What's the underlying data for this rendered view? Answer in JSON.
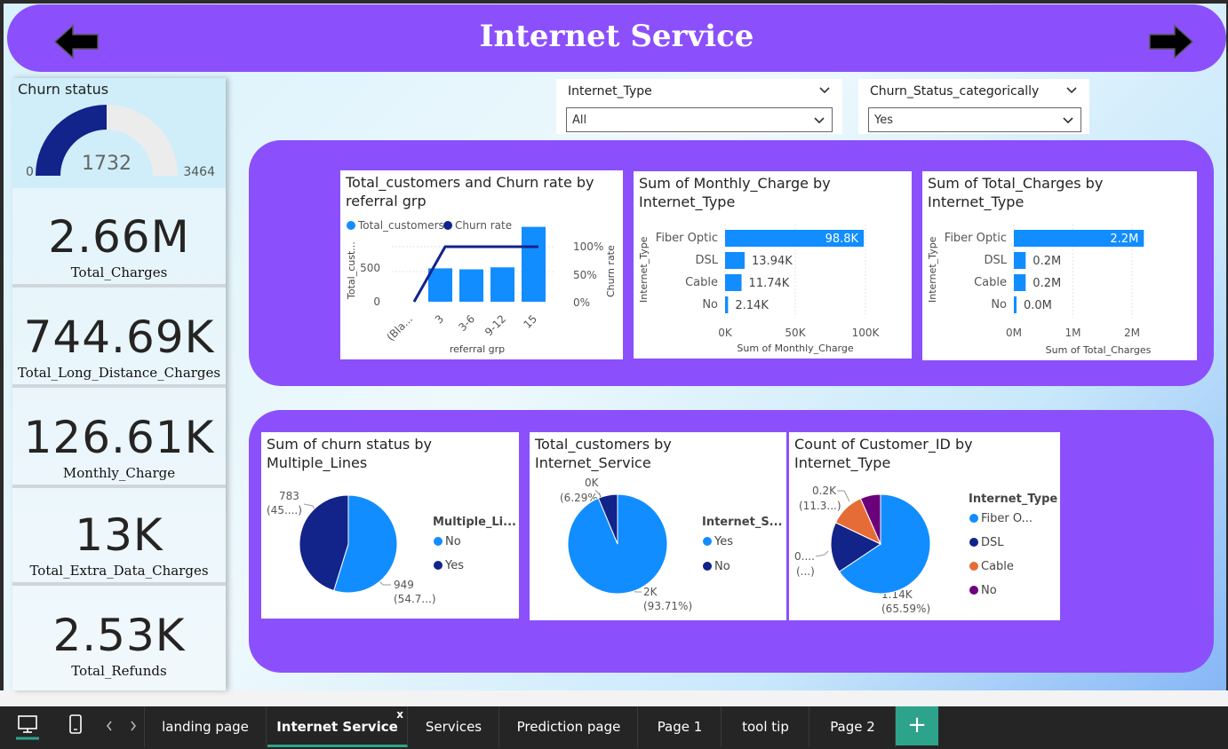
{
  "header": {
    "title": "Internet Service",
    "back_icon": "arrow-left-icon",
    "forward_icon": "arrow-right-icon"
  },
  "gauge": {
    "title": "Churn status",
    "value": "1732",
    "min": "0",
    "max": "3464",
    "fraction": 0.5,
    "fill_color": "#12238a",
    "track_color": "#ececec"
  },
  "kpis": [
    {
      "value": "2.66M",
      "label": "Total_Charges"
    },
    {
      "value": "744.69K",
      "label": "Total_Long_Distance_Charges"
    },
    {
      "value": "126.61K",
      "label": "Monthly_Charge"
    },
    {
      "value": "13K",
      "label": "Total_Extra_Data_Charges"
    },
    {
      "value": "2.53K",
      "label": "Total_Refunds"
    }
  ],
  "slicers": [
    {
      "title": "Internet_Type",
      "value": "All"
    },
    {
      "title": "Churn_Status_categorically",
      "value": "Yes"
    }
  ],
  "colors": {
    "accent": "#8b50fb",
    "bar": "#118dff",
    "dark": "#12238a",
    "orange": "#e66c37",
    "purple": "#6b007b",
    "tab_active": "#2ea38b"
  },
  "chart_data": [
    {
      "type": "bar",
      "title": "Total_customers and Churn rate by referral grp",
      "legend": [
        "Total_customers",
        "Churn rate"
      ],
      "categories": [
        "(Bla...",
        "3",
        "3-6",
        "9-12",
        "15"
      ],
      "series": [
        {
          "name": "Total_customers",
          "values": [
            0,
            330,
            320,
            340,
            740
          ]
        },
        {
          "name": "Churn rate",
          "values": [
            0,
            100,
            100,
            100,
            100
          ]
        }
      ],
      "xlabel": "referral grp",
      "ylabel": "Total_cust...",
      "y2label": "Churn rate",
      "y_ticks": [
        "0",
        "500"
      ],
      "y2_ticks": [
        "0%",
        "50%",
        "100%"
      ]
    },
    {
      "type": "bar",
      "title": "Sum of Monthly_Charge by Internet_Type",
      "categories": [
        "Fiber Optic",
        "DSL",
        "Cable",
        "No"
      ],
      "values": [
        98800,
        13940,
        11740,
        2140
      ],
      "labels": [
        "98.8K",
        "13.94K",
        "11.74K",
        "2.14K"
      ],
      "xlabel": "Sum of Monthly_Charge",
      "ylabel": "Internet_Type",
      "x_ticks": [
        "0K",
        "50K",
        "100K"
      ],
      "xlim": [
        0,
        100000
      ]
    },
    {
      "type": "bar",
      "title": "Sum of Total_Charges by Internet_Type",
      "categories": [
        "Fiber Optic",
        "DSL",
        "Cable",
        "No"
      ],
      "values": [
        2200000,
        200000,
        200000,
        0
      ],
      "labels": [
        "2.2M",
        "0.2M",
        "0.2M",
        "0.0M"
      ],
      "xlabel": "Sum of Total_Charges",
      "ylabel": "Internet_Type",
      "x_ticks": [
        "0M",
        "1M",
        "2M"
      ],
      "xlim": [
        0,
        2000000
      ]
    },
    {
      "type": "pie",
      "title": "Sum of churn status by Multiple_Lines",
      "legend_title": "Multiple_Li...",
      "categories": [
        "No",
        "Yes"
      ],
      "values": [
        949,
        783
      ],
      "labels": [
        [
          "949",
          "(54.7...)"
        ],
        [
          "783",
          "(45....)"
        ]
      ]
    },
    {
      "type": "pie",
      "title": "Total_customers by Internet_Service",
      "legend_title": "Internet_S...",
      "categories": [
        "Yes",
        "No"
      ],
      "values": [
        93.71,
        6.29
      ],
      "labels": [
        [
          "2K",
          "(93.71%)"
        ],
        [
          "0K",
          "(6.29%)"
        ]
      ]
    },
    {
      "type": "pie",
      "title": "Count of Customer_ID by Internet_Type",
      "legend_title": "Internet_Type",
      "categories": [
        "Fiber O...",
        "DSL",
        "Cable",
        "No"
      ],
      "values": [
        65.59,
        16.5,
        11.3,
        6.61
      ],
      "labels": [
        [
          "1.14K",
          "(65.59%)"
        ],
        [
          "0....",
          "(...)"
        ],
        [
          "0.2K",
          "(11.3...)"
        ],
        [
          "",
          ""
        ]
      ]
    }
  ],
  "tabs": [
    "landing page",
    "Internet Service",
    "Services",
    "Prediction page",
    "Page 1",
    "tool tip",
    "Page 2"
  ],
  "active_tab": "Internet Service",
  "tab_close": "x",
  "add_tab": "+"
}
